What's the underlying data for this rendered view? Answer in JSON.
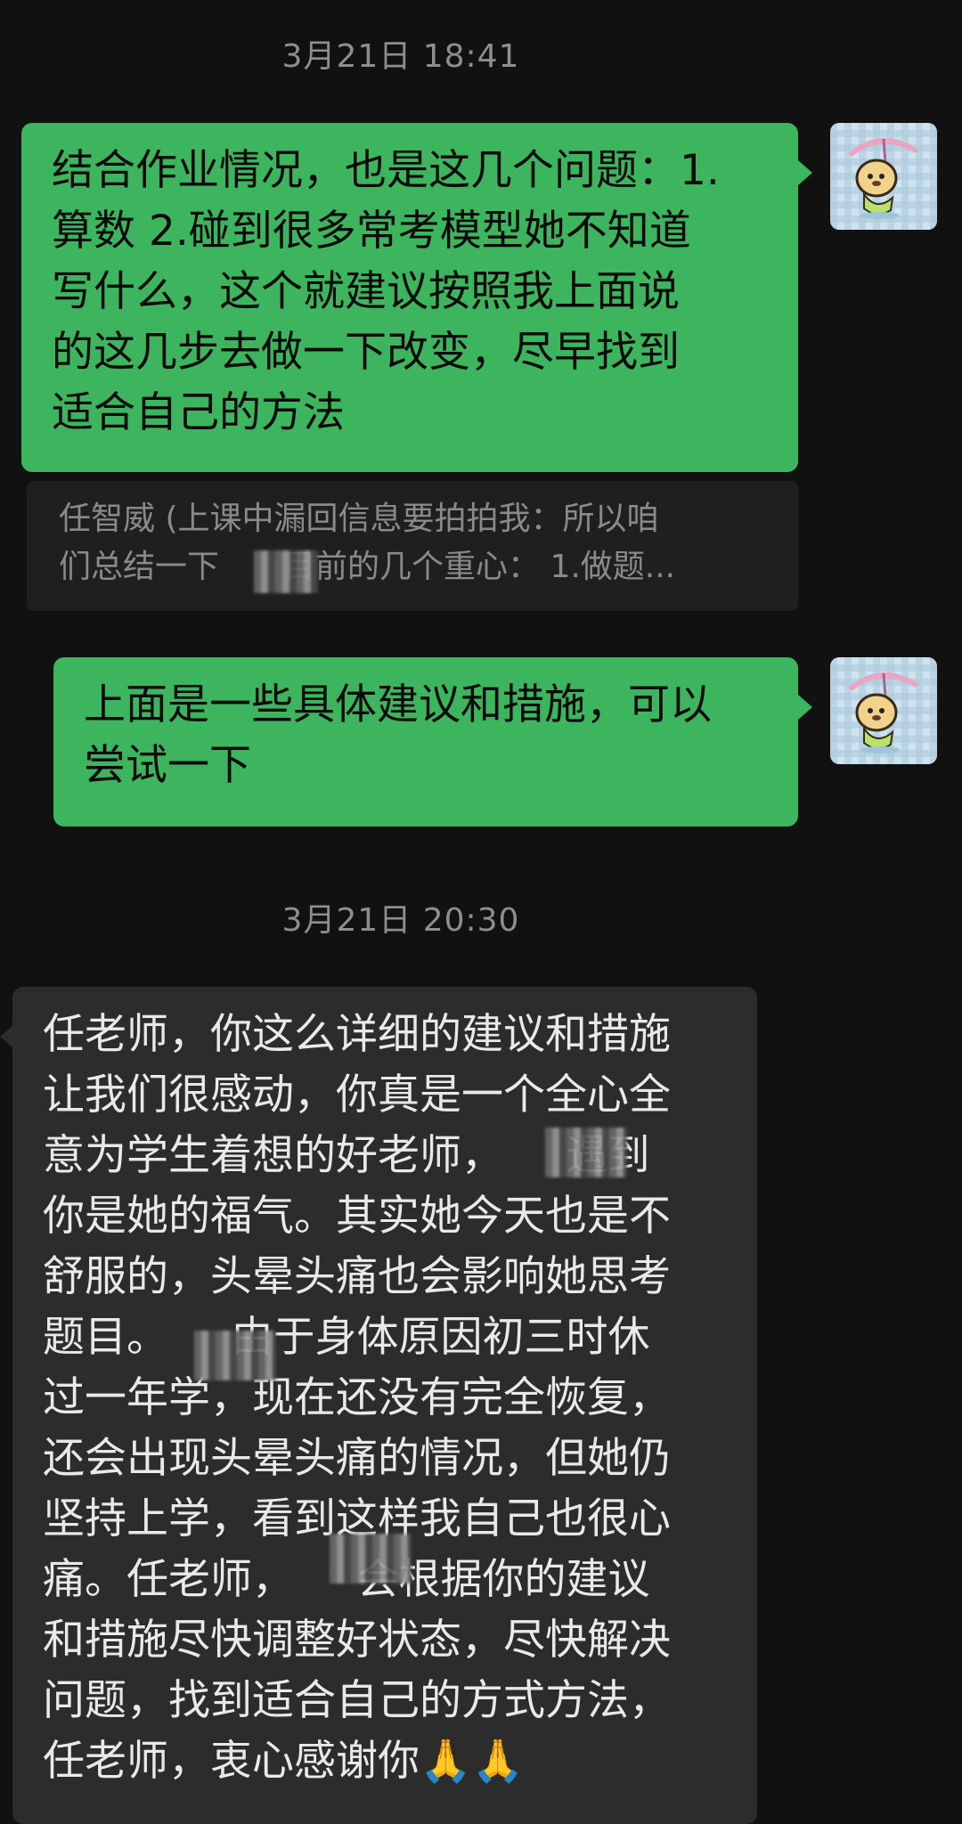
{
  "chat": {
    "timestamp1": "3月21日 18:41",
    "timestamp2": "3月21日 20:30",
    "msg1": "结合作业情况，也是这几个问题：1.\n算数 2.碰到很多常考模型她不知道\n写什么，这个就建议按照我上面说\n的这几步去做一下改变，尽早找到\n适合自己的方法",
    "quote": "任智威 (上课中漏回信息要拍拍我：所以咱\n们总结一下　　目前的几个重心： 1.做题...",
    "msg2": "上面是一些具体建议和措施，可以\n尝试一下",
    "msg3": "任老师，你这么详细的建议和措施\n让我们很感动，你真是一个全心全\n意为学生着想的好老师，　　遇到\n你是她的福气。其实她今天也是不\n舒服的，头晕头痛也会影响她思考\n题目。　　由于身体原因初三时休\n过一年学，现在还没有完全恢复，\n还会出现头晕头痛的情况，但她仍\n坚持上学，看到这样我自己也很心\n痛。任老师，　　会根据你的建议\n和措施尽快调整好状态，尽快解决\n问题，找到适合自己的方式方法，\n任老师，衷心感谢你🙏🙏"
  },
  "colors": {
    "outgoing_bubble": "#3db55e",
    "incoming_bubble": "#2c2c2c",
    "background": "#111111"
  }
}
